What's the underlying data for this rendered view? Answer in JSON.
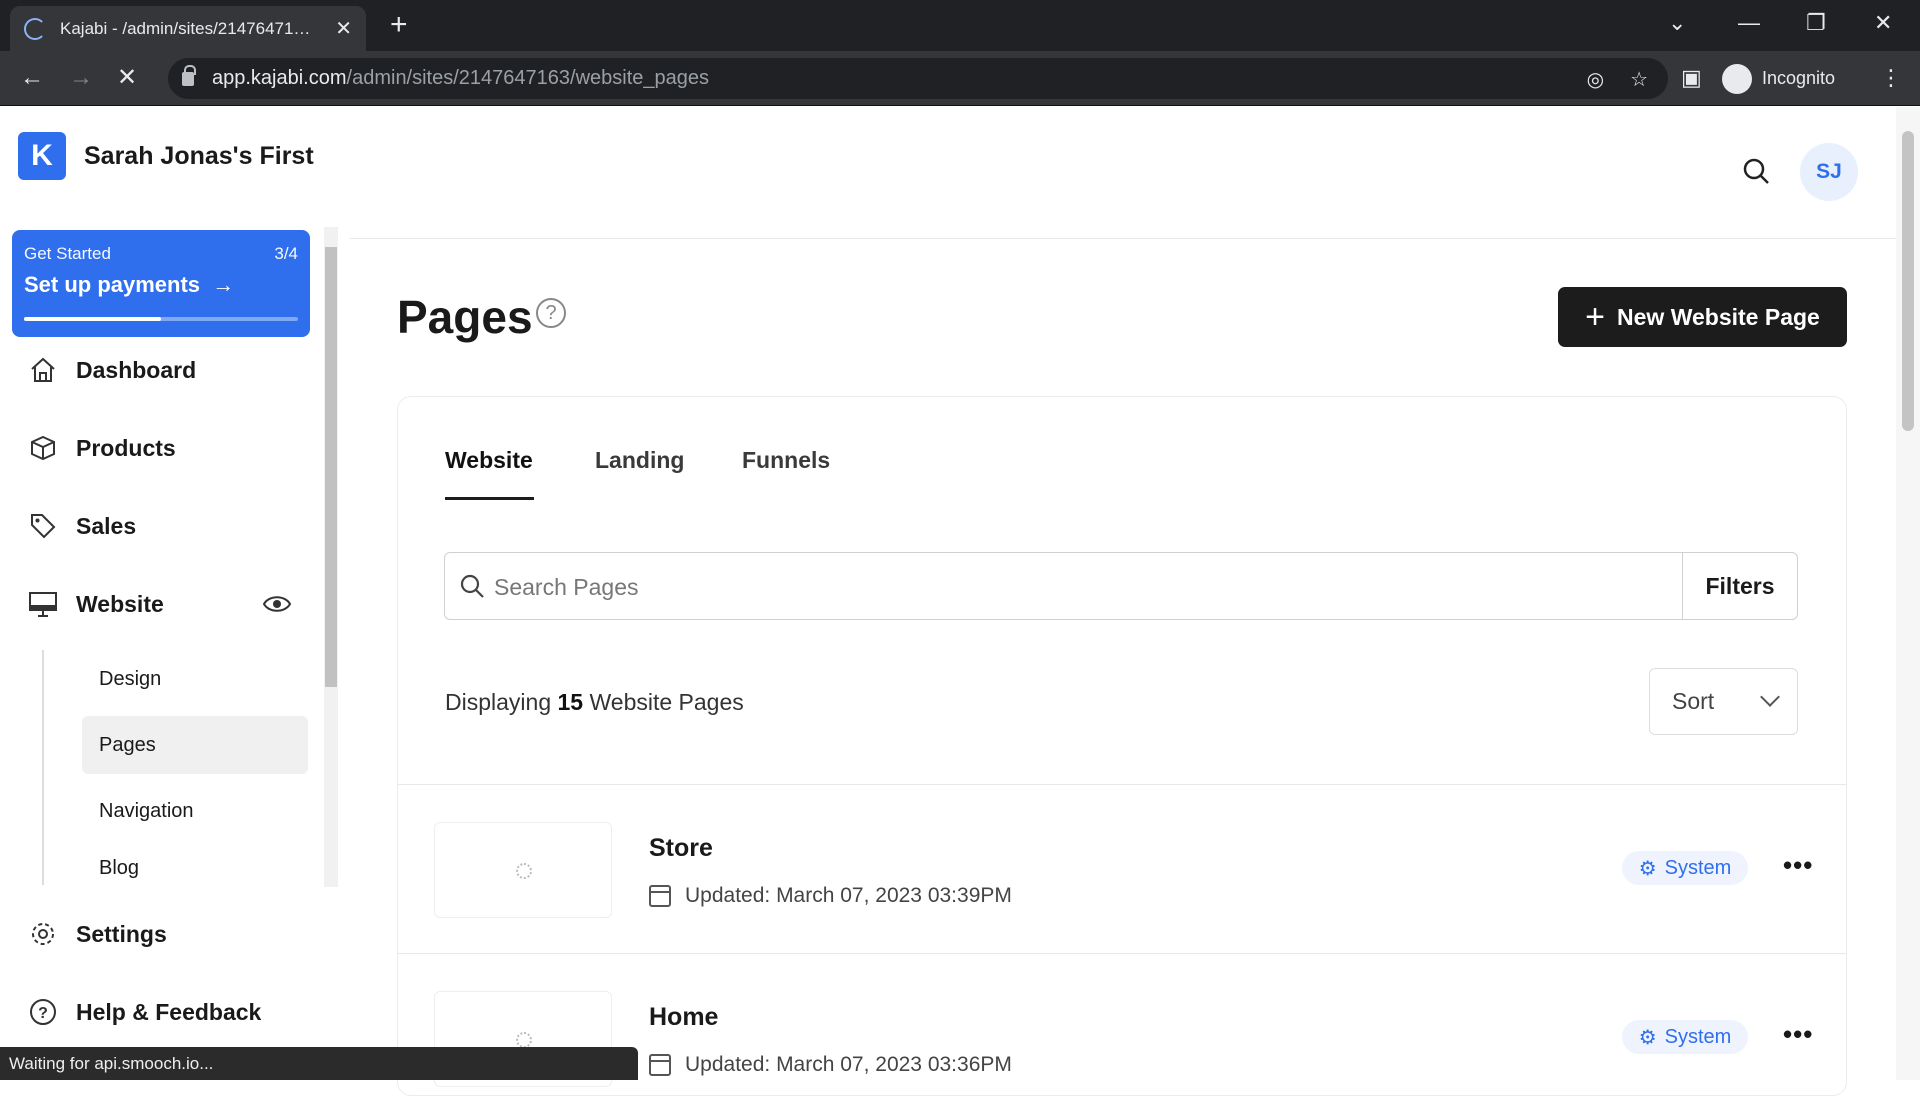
{
  "browser": {
    "tab_title": "Kajabi - /admin/sites/21476471…",
    "url_host": "app.kajabi.com",
    "url_path": "/admin/sites/2147647163/website_pages",
    "profile_label": "Incognito",
    "status_text": "Waiting for api.smooch.io..."
  },
  "sidebar": {
    "site_name": "Sarah Jonas's First",
    "get_started": {
      "label": "Get Started",
      "progress_text": "3/4",
      "action": "Set up payments",
      "progress_fraction": 0.5
    },
    "nav": {
      "dashboard": "Dashboard",
      "products": "Products",
      "sales": "Sales",
      "website": "Website",
      "settings": "Settings",
      "help": "Help & Feedback"
    },
    "website_sub": {
      "design": "Design",
      "pages": "Pages",
      "navigation": "Navigation",
      "blog": "Blog"
    }
  },
  "header": {
    "avatar_initials": "SJ"
  },
  "main": {
    "title": "Pages",
    "new_button": "New Website Page",
    "tabs": {
      "website": "Website",
      "landing": "Landing",
      "funnels": "Funnels"
    },
    "search_placeholder": "Search Pages",
    "filters_label": "Filters",
    "displaying_prefix": "Displaying",
    "displaying_count": "15",
    "displaying_suffix": "Website Pages",
    "sort_label": "Sort",
    "rows": [
      {
        "name": "Store",
        "updated": "Updated: March 07, 2023 03:39PM",
        "badge": "System"
      },
      {
        "name": "Home",
        "updated": "Updated: March 07, 2023 03:36PM",
        "badge": "System"
      }
    ]
  },
  "colors": {
    "brand": "#2f6fed",
    "dark_button": "#1c1c1c"
  }
}
